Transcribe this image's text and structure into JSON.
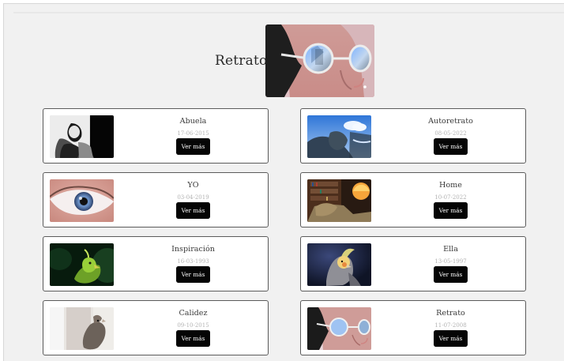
{
  "hero": {
    "title": "Retrato"
  },
  "gallery": [
    {
      "title": "Abuela",
      "date": "17-06-2015",
      "button_label": "Ver más"
    },
    {
      "title": "Autoretrato",
      "date": "08-05-2022",
      "button_label": "Ver más"
    },
    {
      "title": "YO",
      "date": "03-04-2019",
      "button_label": "Ver más"
    },
    {
      "title": "Home",
      "date": "10-07-2022",
      "button_label": "Ver más"
    },
    {
      "title": "Inspiración",
      "date": "16-03-1993",
      "button_label": "Ver más"
    },
    {
      "title": "Ella",
      "date": "13-05-1997",
      "button_label": "Ver más"
    },
    {
      "title": "Calidez",
      "date": "09-10-2015",
      "button_label": "Ver más"
    },
    {
      "title": "Retrato",
      "date": "11-07-2008",
      "button_label": "Ver más"
    }
  ]
}
